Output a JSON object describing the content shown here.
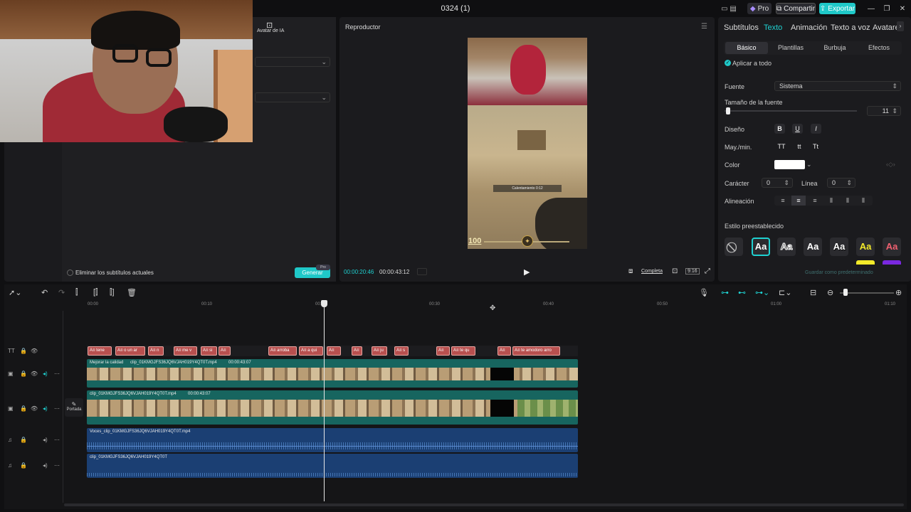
{
  "window": {
    "title": "0324 (1)",
    "pro_label": "Pro",
    "share_label": "Compartir",
    "export_label": "Exportar"
  },
  "left_panel": {
    "tab_avatar_label": "Avatar de IA",
    "remove_subs_label": "Eliminar los subtítulos actuales",
    "generate_label": "Generar",
    "pro_badge": "Pro"
  },
  "player": {
    "title": "Reproductor",
    "current_time": "00:00:20:46",
    "total_time": "00:00:43:12",
    "fit_label": "Completa",
    "ratio_label": "9:16",
    "hud_value": "100",
    "caption_text": "Calentamiento 0:12"
  },
  "right_panel": {
    "tabs": [
      "Subtítulos",
      "Texto",
      "Animación",
      "Texto a voz",
      "Avatare"
    ],
    "active_tab": "Texto",
    "subtabs": [
      "Básico",
      "Plantillas",
      "Burbuja",
      "Efectos"
    ],
    "apply_all_label": "Aplicar a todo",
    "font_label": "Fuente",
    "font_value": "Sistema",
    "size_label": "Tamaño de la fuente",
    "size_value": "11",
    "design_label": "Diseño",
    "design_buttons": [
      "B",
      "U",
      "I"
    ],
    "case_label": "May./min.",
    "case_buttons": [
      "TT",
      "tt",
      "Tt"
    ],
    "color_label": "Color",
    "color_value": "#ffffff",
    "char_label": "Carácter",
    "char_value": "0",
    "line_label": "Línea",
    "line_value": "0",
    "align_label": "Alineación",
    "preset_label": "Estilo preestablecido",
    "preset_sample": "Aa",
    "save_preset_label": "Guardar como predeterminado"
  },
  "timeline": {
    "ruler": [
      "00:00",
      "00:10",
      "00:20",
      "00:30",
      "00:40",
      "00:50",
      "01:00",
      "01:10"
    ],
    "subtitle_clips": [
      "tene",
      "o un ar",
      "n",
      "me v",
      "si",
      "",
      "arroba",
      "a qui",
      "",
      "",
      "ju",
      "s",
      "",
      "te qu",
      "",
      "te amodoro arro"
    ],
    "video1_labels": [
      "Mejorar la calidad",
      "clip_01KMGJFS36JQ6VJAH019Y4QT0T.mp4",
      "00:00:43:07"
    ],
    "video2_labels": [
      "clip_01KMGJFS36JQ6VJAH019Y4QT0T.mp4",
      "00:00:43:07"
    ],
    "cover_label": "Portada",
    "audio1_label": "Voces_clip_01KMGJFS36JQ6VJAH019Y4QT0T.mp4",
    "audio2_label": "clip_01KMGJFS36JQ6VJAH019Y4QT0T"
  },
  "colors": {
    "accent": "#1fd1d1",
    "subtitle_clip": "#b8504f",
    "video_track": "#17655f",
    "audio_track": "#1b3f73"
  }
}
